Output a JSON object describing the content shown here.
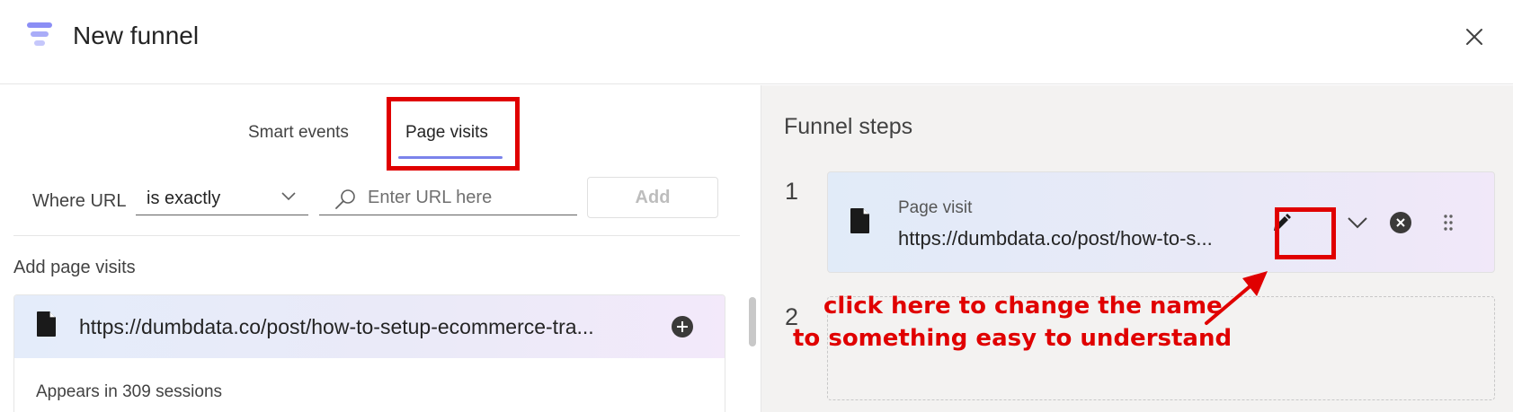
{
  "header": {
    "title": "New funnel",
    "logo_icon": "funnel-logo-icon",
    "close_icon": "close-icon"
  },
  "tabs": [
    {
      "label": "Smart events",
      "active": false
    },
    {
      "label": "Page visits",
      "active": true
    }
  ],
  "filter": {
    "where_label": "Where URL",
    "operator_value": "is exactly",
    "url_placeholder": "Enter URL here",
    "add_label": "Add"
  },
  "page_visits": {
    "section_label": "Add page visits",
    "items": [
      {
        "url": "https://dumbdata.co/post/how-to-setup-ecommerce-tra...",
        "sessions_text": "Appears in 309 sessions"
      }
    ]
  },
  "funnel": {
    "title": "Funnel steps",
    "steps": [
      {
        "number": "1",
        "type": "Page visit",
        "url": "https://dumbdata.co/post/how-to-s..."
      },
      {
        "number": "2"
      }
    ]
  },
  "annotation": {
    "line1": "click here to change the name",
    "line2": "to something easy to understand"
  },
  "colors": {
    "accent": "#7b83eb",
    "highlight": "#e00000",
    "right_panel_bg": "#f3f2f1"
  }
}
